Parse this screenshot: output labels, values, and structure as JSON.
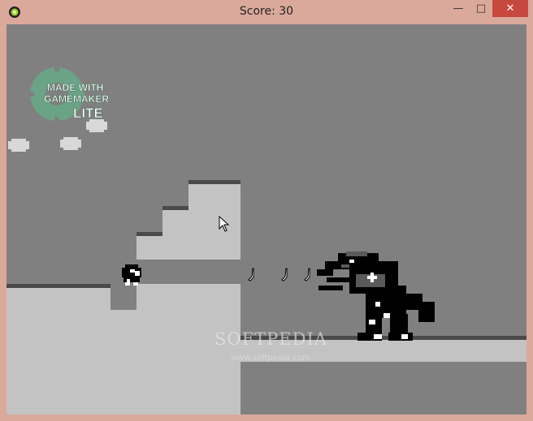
{
  "window": {
    "title": "Score: 30",
    "minimize_glyph": "—",
    "maximize_glyph": "□",
    "close_glyph": "✕"
  },
  "game": {
    "logo": {
      "line1": "MADE WITH",
      "line2": "GAMEMAKER",
      "line3": "LITE"
    },
    "score": 30,
    "bananas_visible": 3,
    "watermark": {
      "brand": "SOFTPEDIA",
      "url": "www.softpedia.com"
    }
  },
  "colors": {
    "background": "#808080",
    "ground": "#c3c3c3",
    "grass": "#4a4a4a",
    "window_frame": "#dba99b",
    "close_button": "#c7483d"
  }
}
